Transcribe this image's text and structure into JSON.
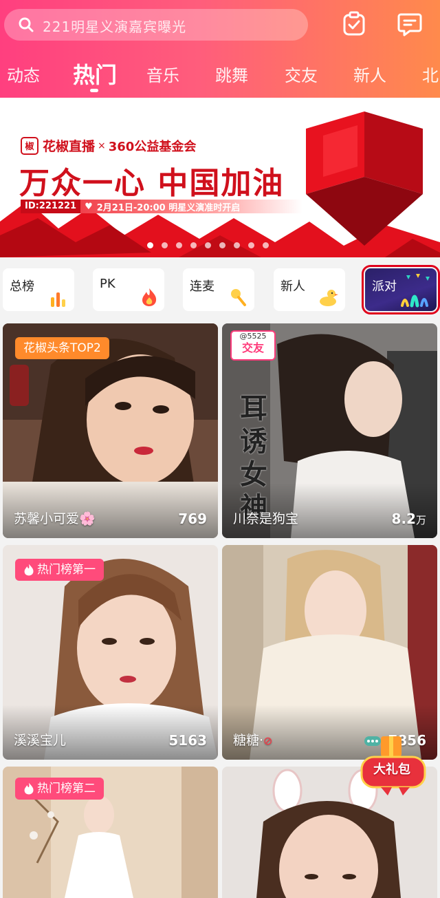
{
  "header": {
    "search_placeholder": "221明星义演嘉宾曝光",
    "tabs": [
      "动态",
      "热门",
      "音乐",
      "跳舞",
      "交友",
      "新人",
      "北"
    ],
    "active_tab": "热门"
  },
  "banner": {
    "brand": "花椒直播",
    "cross": "×",
    "partner": "360公益基金会",
    "headline": "万众一心 中国加油",
    "sub_id": "ID:221221",
    "sub_text": "2月21日-20:00 明星义演准时开启",
    "page_count": 9,
    "active_page": 0
  },
  "categories": [
    {
      "label": "总榜",
      "icon": "bar-chart-icon"
    },
    {
      "label": "PK",
      "icon": "flame-icon"
    },
    {
      "label": "连麦",
      "icon": "microphone-icon"
    },
    {
      "label": "新人",
      "icon": "duck-icon"
    },
    {
      "label": "派对",
      "icon": "party-icon"
    }
  ],
  "cards": [
    {
      "name": "苏馨小可爱🌸",
      "count": "769",
      "badge": "花椒头条TOP2"
    },
    {
      "name": "川奈是狗宝",
      "count": "8.2",
      "count_unit": "万",
      "tag_id": "@5525",
      "tag_label": "交友",
      "poster_text": "耳诱女神"
    },
    {
      "name": "溪溪宝儿",
      "count": "5163",
      "badge": "热门榜第一"
    },
    {
      "name": "糖糖·",
      "count": "7856"
    },
    {
      "badge": "热门榜第二"
    },
    {}
  ],
  "gift": {
    "label": "大礼包"
  },
  "colors": {
    "header_start": "#ff3f7f",
    "header_end": "#ff8a4c",
    "banner_red": "#d0101c",
    "badge_orange": "#ff8a2b",
    "badge_pink": "#ff4b7b",
    "highlight_outline": "#e0001b"
  }
}
